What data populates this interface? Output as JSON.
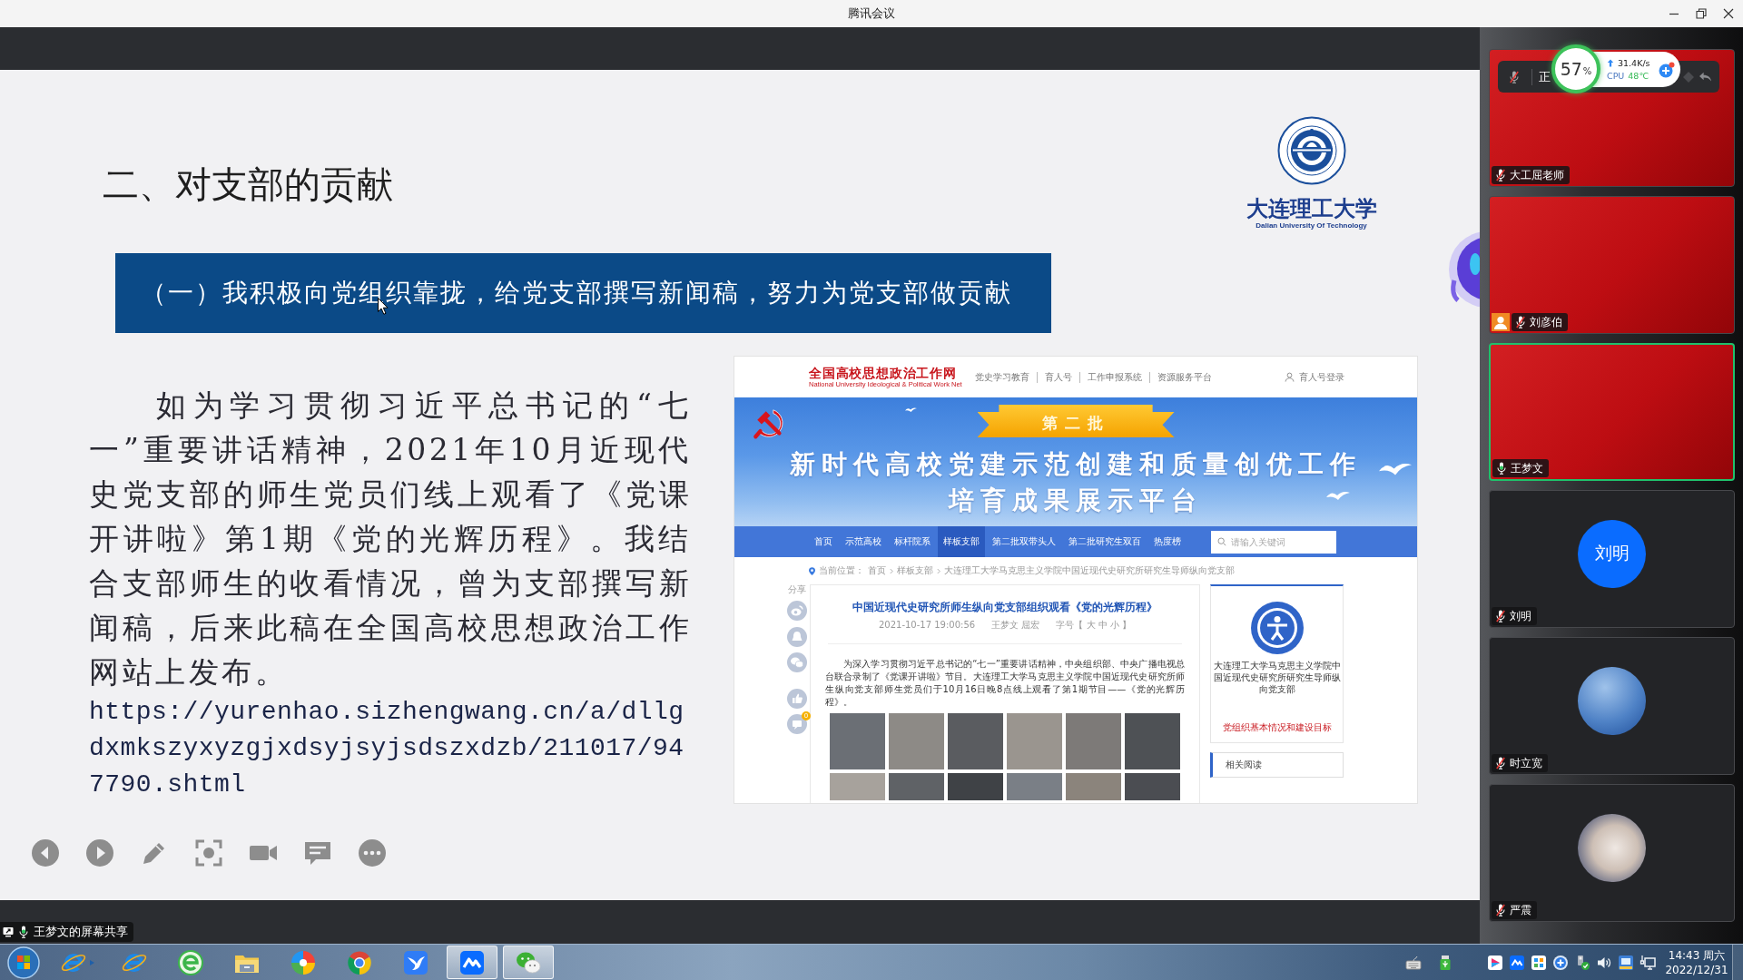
{
  "window": {
    "title": "腾讯会议"
  },
  "slide": {
    "heading": "二、对支部的贡献",
    "logo": {
      "name": "大连理工大学",
      "name_en": "Dalian University Of Technology"
    },
    "banner": "（一）我积极向党组织靠拢，给党支部撰写新闻稿，努力为党支部做贡献",
    "paragraph": "如为学习贯彻习近平总书记的“七一”重要讲话精神，2021年10月近现代史党支部的师生党员们线上观看了《党课开讲啦》第1期《党的光辉历程》。我结合支部师生的收看情况，曾为支部撰写新闻稿，后来此稿在全国高校思想政治工作网站上发布。",
    "link": "https://yurenhao.sizhengwang.cn/a/dllgdxmkszyxyzgjxdsyjsyjsdszxdzb/211017/947790.shtml",
    "webpage": {
      "site_name": "全国高校思想政治工作网",
      "site_name_en": "National University Ideological & Political Work Net",
      "top_links": [
        "党史学习教育",
        "育人号",
        "工作申报系统",
        "资源服务平台"
      ],
      "login": "育人号登录",
      "banner": {
        "ribbon": "第二批",
        "title_lines": [
          "新时代高校党建示范创建和质量创优工作",
          "培育成果展示平台"
        ]
      },
      "nav": [
        {
          "label": "首页",
          "selected": false
        },
        {
          "label": "示范高校",
          "selected": false
        },
        {
          "label": "标杆院系",
          "selected": false
        },
        {
          "label": "样板支部",
          "selected": true
        },
        {
          "label": "第二批双带头人",
          "selected": false
        },
        {
          "label": "第二批研究生双百",
          "selected": false
        },
        {
          "label": "热度榜",
          "selected": false
        }
      ],
      "search": {
        "placeholder": "请输入关键词"
      },
      "breadcrumb": {
        "label": "当前位置：",
        "items": [
          "首页",
          "样板支部",
          "大连理工大学马克思主义学院中国近现代史研究所研究生导师纵向党支部"
        ]
      },
      "share": {
        "label": "分享",
        "comment_count": "0"
      },
      "article": {
        "title": "中国近现代史研究所师生纵向党支部组织观看《党的光辉历程》",
        "date": "2021-10-17 19:00:56",
        "authors": "王梦文 屈宏",
        "font_size": "字号【 大 中 小 】",
        "body": "为深入学习贯彻习近平总书记的“七一”重要讲话精神，中央组织部、中央广播电视总台联合录制了《党课开讲啦》节目。大连理工大学马克思主义学院中国近现代史研究所师生纵向党支部师生党员们于10月16日晚8点线上观看了第1期节目——《党的光辉历程》。"
      },
      "side_card": {
        "name": "大连理工大学马克思主义学院中国近现代史研究所研究生导师纵向党支部",
        "link": "党组织基本情况和建设目标"
      },
      "related": "相关阅读"
    }
  },
  "sharer_label": "王梦文的屏幕共享",
  "participants": [
    {
      "name": "大工屈老师",
      "kind": "video",
      "muted": true,
      "speaking": false,
      "host": false
    },
    {
      "name": "刘彦伯",
      "kind": "video",
      "muted": true,
      "speaking": false,
      "host": true
    },
    {
      "name": "王梦文",
      "kind": "video",
      "muted": false,
      "speaking": true,
      "host": false
    },
    {
      "name": "刘明",
      "kind": "initials",
      "avatar_text": "刘明",
      "muted": true,
      "speaking": false,
      "host": false
    },
    {
      "name": "时立宽",
      "kind": "photo",
      "muted": true,
      "speaking": false,
      "host": false
    },
    {
      "name": "严震",
      "kind": "photo",
      "muted": true,
      "speaking": false,
      "host": false
    }
  ],
  "floating_bar": {
    "status": "正"
  },
  "monitor": {
    "value": "57",
    "unit": "%",
    "upload": "31.4K/s",
    "cpu_label": "CPU",
    "cpu_temp": "48℃"
  },
  "taskbar": {
    "apps": [
      {
        "kind": "ie-pinned",
        "running": false
      },
      {
        "kind": "ie",
        "running": false
      },
      {
        "kind": "green-e",
        "running": false
      },
      {
        "kind": "folder",
        "running": false
      },
      {
        "kind": "pinwheel",
        "running": false
      },
      {
        "kind": "tricolor",
        "running": false
      },
      {
        "kind": "bird",
        "running": false
      },
      {
        "kind": "meeting",
        "running": true
      },
      {
        "kind": "wechat",
        "running": true
      }
    ],
    "clock": {
      "time": "14:43 周六",
      "date": "2022/12/31"
    }
  }
}
